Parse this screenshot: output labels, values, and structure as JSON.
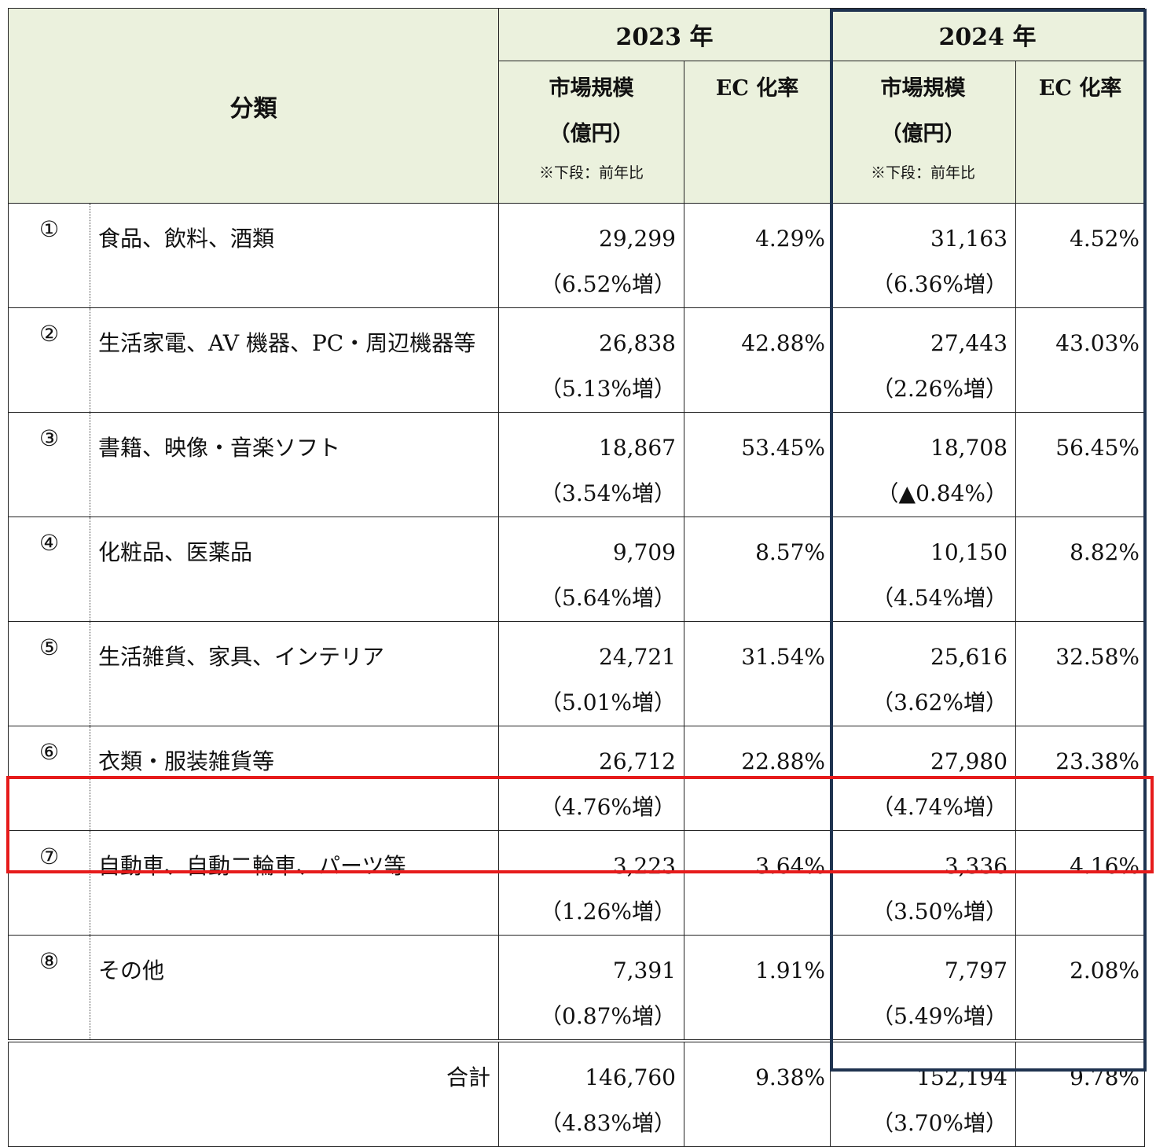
{
  "header": {
    "category": "分類",
    "years": [
      "2023 年",
      "2024 年"
    ],
    "market_line1": "市場規模",
    "market_line2": "（億円）",
    "market_note": "※下段：前年比",
    "ec_rate": "EC 化率"
  },
  "rows": [
    {
      "num": "①",
      "name": "食品、飲料、酒類",
      "y2023": {
        "value": "29,299",
        "change": "（6.52%増）",
        "rate": "4.29%"
      },
      "y2024": {
        "value": "31,163",
        "change": "（6.36%増）",
        "rate": "4.52%"
      }
    },
    {
      "num": "②",
      "name": "生活家電、AV 機器、PC・周辺機器等",
      "y2023": {
        "value": "26,838",
        "change": "（5.13%増）",
        "rate": "42.88%"
      },
      "y2024": {
        "value": "27,443",
        "change": "（2.26%増）",
        "rate": "43.03%"
      }
    },
    {
      "num": "③",
      "name": "書籍、映像・音楽ソフト",
      "y2023": {
        "value": "18,867",
        "change": "（3.54%増）",
        "rate": "53.45%"
      },
      "y2024": {
        "value": "18,708",
        "change": "（▲0.84%）",
        "rate": "56.45%"
      }
    },
    {
      "num": "④",
      "name": "化粧品、医薬品",
      "y2023": {
        "value": "9,709",
        "change": "（5.64%増）",
        "rate": "8.57%"
      },
      "y2024": {
        "value": "10,150",
        "change": "（4.54%増）",
        "rate": "8.82%"
      }
    },
    {
      "num": "⑤",
      "name": "生活雑貨、家具、インテリア",
      "y2023": {
        "value": "24,721",
        "change": "（5.01%増）",
        "rate": "31.54%"
      },
      "y2024": {
        "value": "25,616",
        "change": "（3.62%増）",
        "rate": "32.58%"
      }
    },
    {
      "num": "⑥",
      "name": "衣類・服装雑貨等",
      "y2023": {
        "value": "26,712",
        "change": "（4.76%増）",
        "rate": "22.88%"
      },
      "y2024": {
        "value": "27,980",
        "change": "（4.74%増）",
        "rate": "23.38%"
      }
    },
    {
      "num": "⑦",
      "name": "自動車、自動二輪車、パーツ等",
      "y2023": {
        "value": "3,223",
        "change": "（1.26%増）",
        "rate": "3.64%"
      },
      "y2024": {
        "value": "3,336",
        "change": "（3.50%増）",
        "rate": "4.16%"
      }
    },
    {
      "num": "⑧",
      "name": "その他",
      "y2023": {
        "value": "7,391",
        "change": "（0.87%増）",
        "rate": "1.91%"
      },
      "y2024": {
        "value": "7,797",
        "change": "（5.49%増）",
        "rate": "2.08%"
      }
    }
  ],
  "total": {
    "label": "合計",
    "y2023": {
      "value": "146,760",
      "change": "（4.83%増）",
      "rate": "9.38%"
    },
    "y2024": {
      "value": "152,194",
      "change": "（3.70%増）",
      "rate": "9.78%"
    }
  },
  "colors": {
    "header_bg": "#ebf1dd",
    "highlight_2024": "#1f3350",
    "highlight_row": "#e61b1b"
  }
}
